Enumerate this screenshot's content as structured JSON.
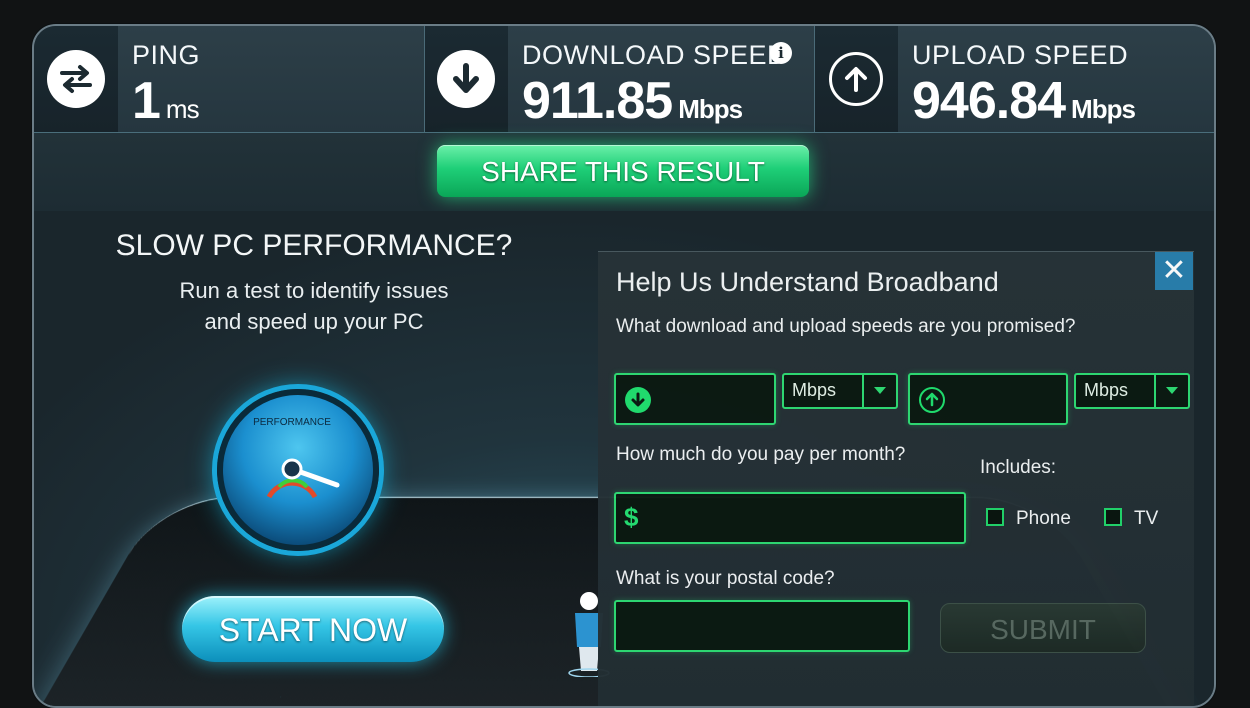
{
  "stats": {
    "ping": {
      "label": "PING",
      "value": "1",
      "unit": "ms",
      "icon": "ping-arrows-icon"
    },
    "download": {
      "label": "DOWNLOAD SPEED",
      "value": "911.85",
      "unit": "Mbps",
      "icon": "download-arrow-icon",
      "info_icon": "i"
    },
    "upload": {
      "label": "UPLOAD SPEED",
      "value": "946.84",
      "unit": "Mbps",
      "icon": "upload-arrow-icon"
    }
  },
  "share": {
    "label": "SHARE THIS RESULT"
  },
  "promo": {
    "title": "SLOW PC PERFORMANCE?",
    "line1": "Run a test to identify issues",
    "line2": "and speed up your PC",
    "gauge_label": "PERFORMANCE",
    "start_label": "START NOW"
  },
  "survey": {
    "title": "Help Us Understand Broadband",
    "close_label": "✕",
    "question_speed": "What download and upload speeds are you promised?",
    "download_unit": "Mbps",
    "upload_unit": "Mbps",
    "question_pay": "How much do you pay per month?",
    "currency_symbol": "$",
    "includes_label": "Includes:",
    "phone_label": "Phone",
    "tv_label": "TV",
    "question_postal": "What is your postal code?",
    "submit_label": "SUBMIT"
  },
  "colors": {
    "accent_green": "#2fdc74",
    "accent_cyan": "#1aa7d9",
    "close_blue": "#2a7fae"
  }
}
